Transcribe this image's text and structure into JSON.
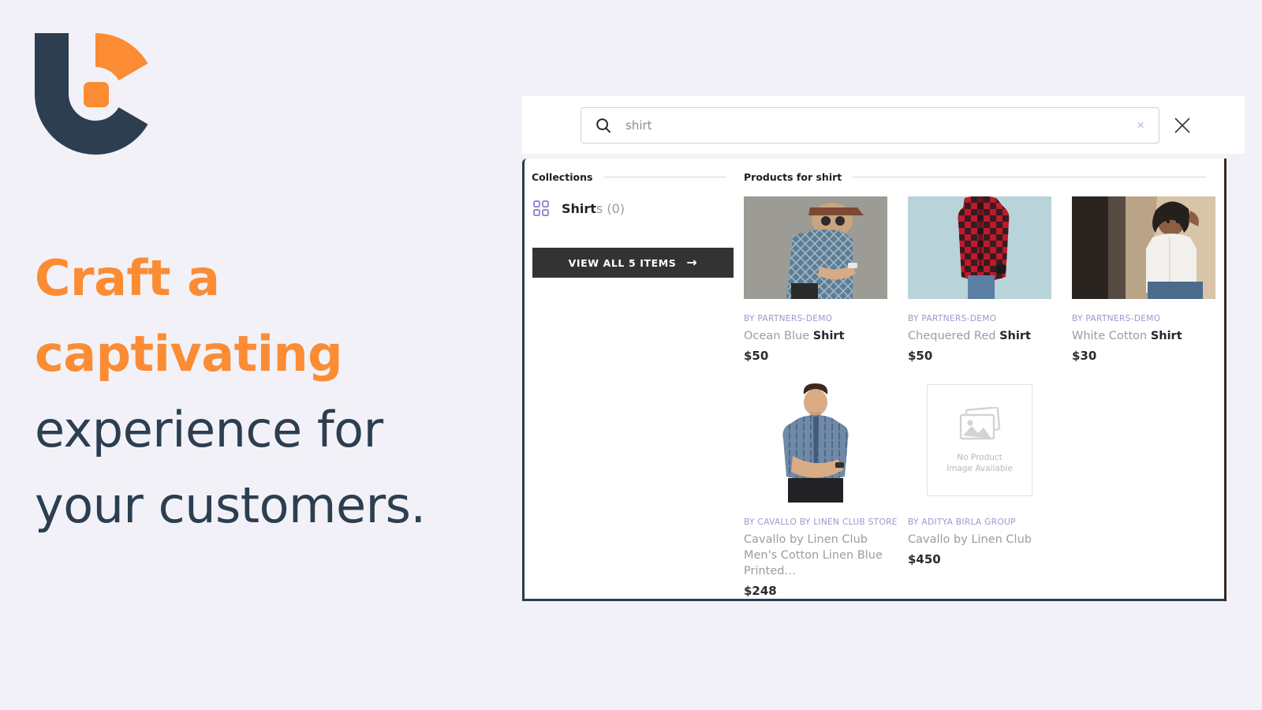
{
  "hero": {
    "logo_name": "bc-logo",
    "heading_accent_line1": "Craft a",
    "heading_accent_line2": "captivating",
    "heading_line3": "experience for",
    "heading_line4": "your customers.",
    "accent_color": "#fb8c34",
    "text_color": "#2c3e50",
    "background_color": "#f1f1f7"
  },
  "search": {
    "icon": "search-icon",
    "value": "shirt",
    "placeholder": "Search",
    "clear_label": "×",
    "close_label": "close-icon"
  },
  "collections": {
    "heading": "Collections",
    "items": [
      {
        "icon": "grid-icon",
        "name_bold": "Shirt",
        "name_rest": "s",
        "count": "(0)"
      }
    ],
    "view_all_label": "VIEW ALL 5 ITEMS",
    "view_all_arrow": "→"
  },
  "products_section": {
    "heading": "Products for shirt",
    "no_image_line1": "No Product",
    "no_image_line2": "Image Available",
    "items": [
      {
        "vendor": "BY PARTNERS-DEMO",
        "title_plain": "Ocean Blue ",
        "title_bold": "Shirt",
        "price": "$50",
        "image": "man-patterned-blue-shirt-concrete-wall",
        "has_image": true
      },
      {
        "vendor": "BY PARTNERS-DEMO",
        "title_plain": "Chequered Red ",
        "title_bold": "Shirt",
        "price": "$50",
        "image": "man-red-black-plaid-flannel",
        "has_image": true
      },
      {
        "vendor": "BY PARTNERS-DEMO",
        "title_plain": "White Cotton ",
        "title_bold": "Shirt",
        "price": "$30",
        "image": "woman-white-shirt-street",
        "has_image": true
      },
      {
        "vendor": "BY CAVALLO BY LINEN CLUB STORE",
        "title_plain": "Cavallo by Linen Club Men's Cotton Linen Blue Printed…",
        "title_bold": "",
        "price": "$248",
        "image": "man-blue-printed-linen-shirt-white-bg",
        "has_image": true
      },
      {
        "vendor": "BY ADITYA BIRLA GROUP",
        "title_plain": "Cavallo by Linen Club",
        "title_bold": "",
        "price": "$450",
        "image": "no-product-image-placeholder",
        "has_image": false
      }
    ]
  },
  "colors": {
    "panel_border_left": "#2c3e50",
    "panel_border_right": "#3b2522",
    "vendor_text": "#9a9ad0",
    "button_bg": "#333333"
  }
}
